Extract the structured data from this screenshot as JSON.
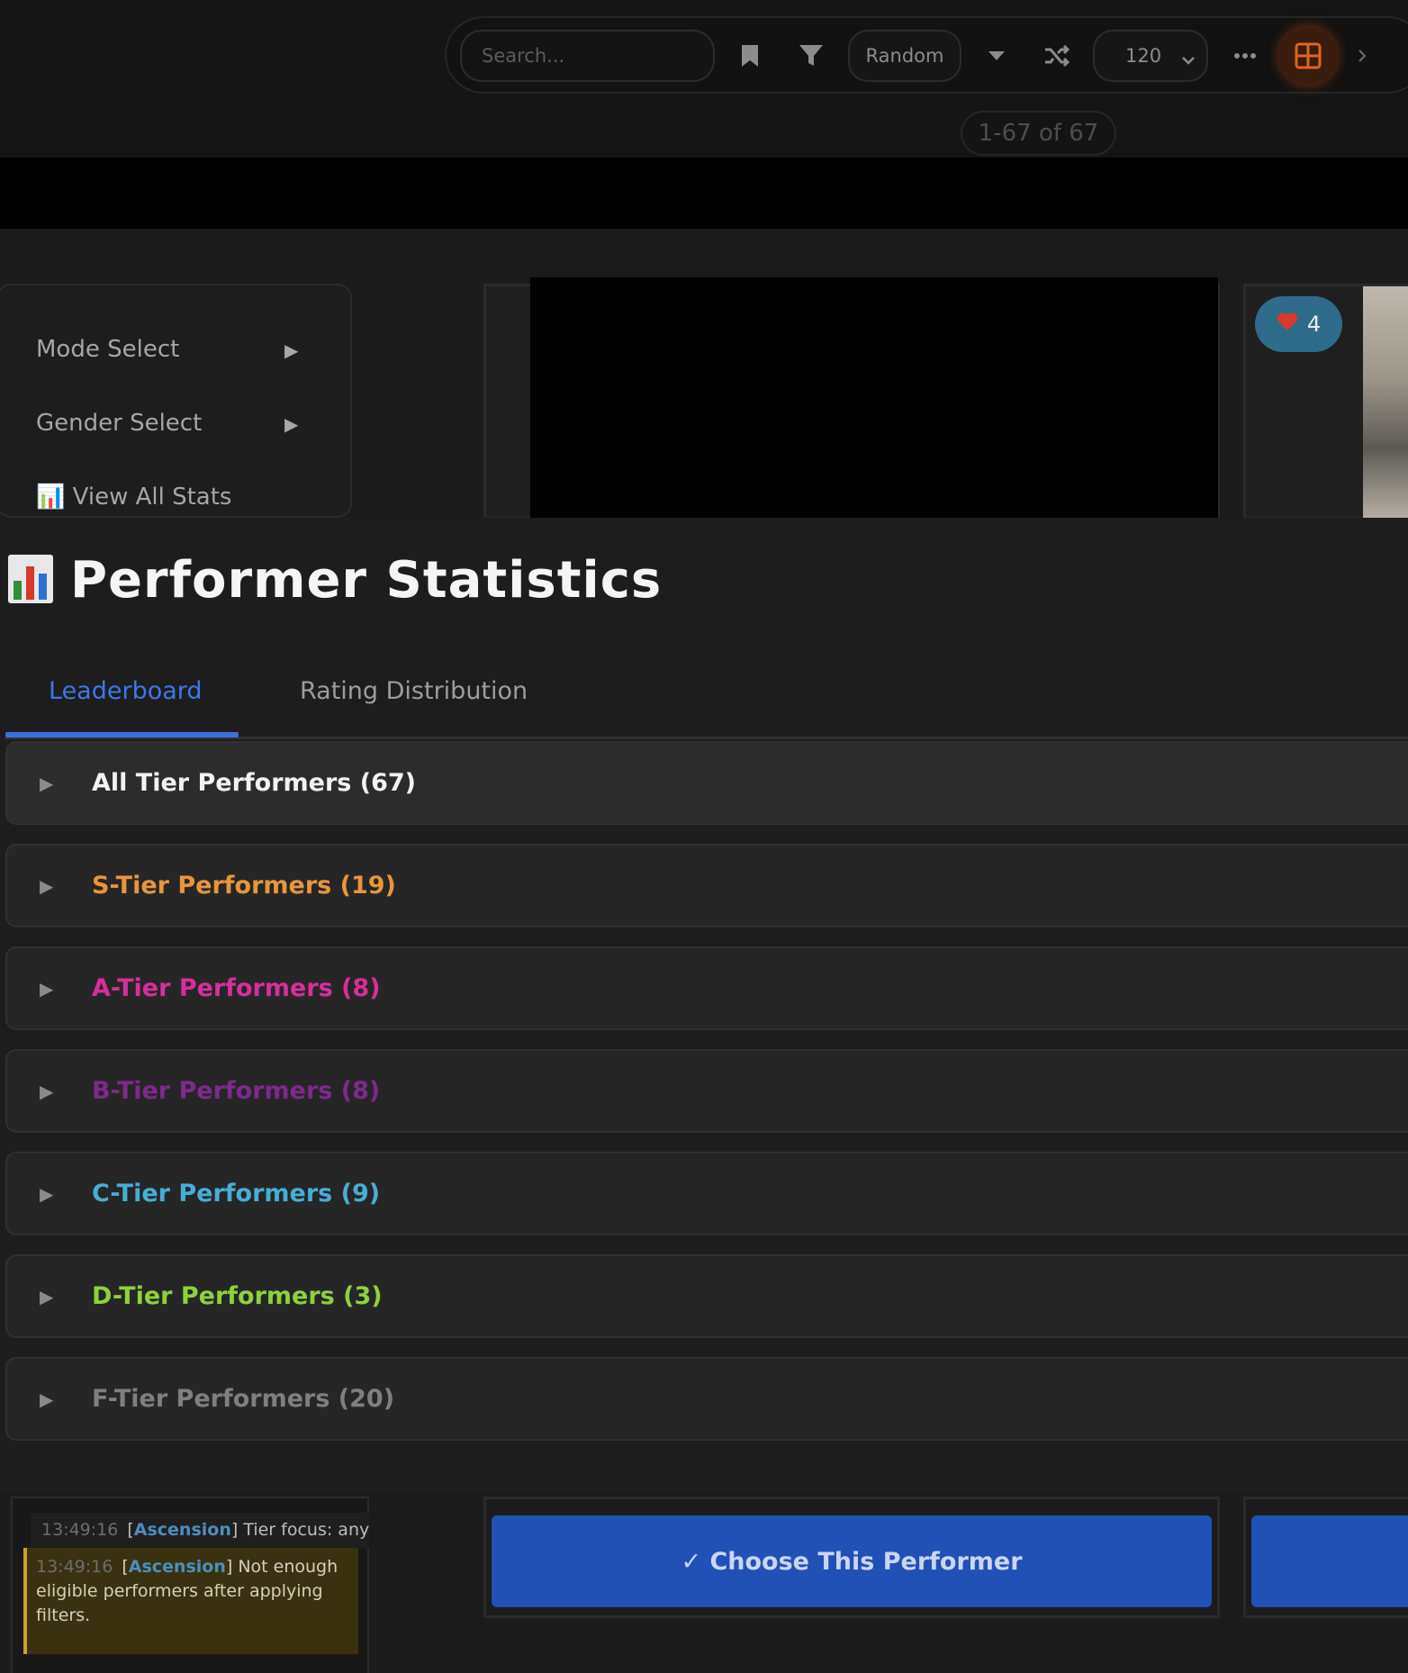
{
  "toolbar": {
    "search_placeholder": "Search...",
    "sort_label": "Random",
    "per_page": "120",
    "result_count": "1-67 of 67"
  },
  "side_menu": {
    "items": [
      {
        "label": "Mode Select",
        "arrow": "▶"
      },
      {
        "label": "Gender Select",
        "arrow": "▶"
      },
      {
        "label": "View All Stats",
        "icon": "📊"
      }
    ]
  },
  "performer_card": {
    "badge_count": "4",
    "badge_icon": "heart-icon"
  },
  "stats_modal": {
    "title_icon": "📊",
    "title": "Performer Statistics",
    "tabs": [
      {
        "label": "Leaderboard",
        "active": true
      },
      {
        "label": "Rating Distribution",
        "active": false
      }
    ],
    "tiers": [
      {
        "label": "All Tier Performers (67)",
        "color": "#f2f2f2"
      },
      {
        "label": "S-Tier Performers (19)",
        "color": "#e8953c"
      },
      {
        "label": "A-Tier Performers (8)",
        "color": "#d62f9b"
      },
      {
        "label": "B-Tier Performers (8)",
        "color": "#7b2b8a"
      },
      {
        "label": "C-Tier Performers (9)",
        "color": "#46aed6"
      },
      {
        "label": "D-Tier Performers (3)",
        "color": "#8fd13c"
      },
      {
        "label": "F-Tier Performers (20)",
        "color": "#7f7f7f"
      }
    ],
    "tier_arrow": "▶"
  },
  "log": [
    {
      "time": "13:49:16",
      "tag": "Ascension",
      "message": "Tier focus: any"
    },
    {
      "time": "13:49:16",
      "tag": "Ascension",
      "message": "Not enough eligible performers after applying filters."
    }
  ],
  "choose_button": "✓ Choose This Performer",
  "colors": {
    "accent": "#3a6fe0",
    "choose_bg": "#2150b6",
    "warning_border": "#c9a227"
  }
}
